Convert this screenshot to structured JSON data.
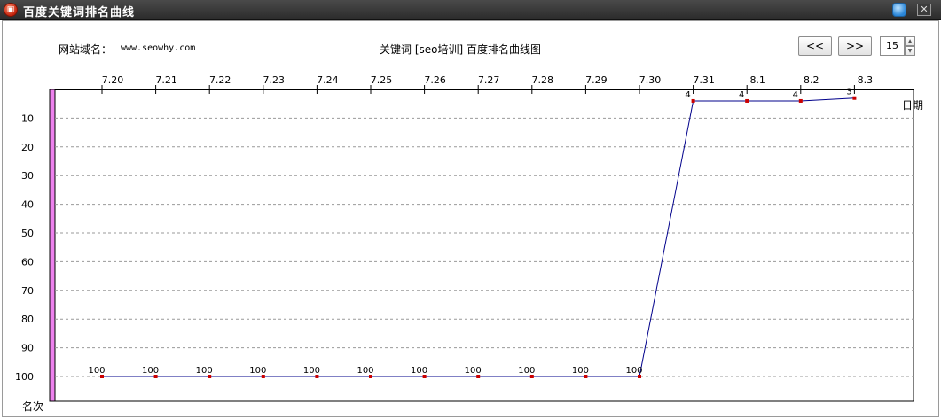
{
  "window": {
    "title": "百度关键词排名曲线"
  },
  "header": {
    "site_label": "网站域名：",
    "site_value": "www.seowhy.com",
    "chart_title": "关键词 [seo培训] 百度排名曲线图",
    "prev_label": "<<",
    "next_label": ">>",
    "days_value": "15"
  },
  "chart_data": {
    "type": "line",
    "x": [
      "7.20",
      "7.21",
      "7.22",
      "7.23",
      "7.24",
      "7.25",
      "7.26",
      "7.27",
      "7.28",
      "7.29",
      "7.30",
      "7.31",
      "8.1",
      "8.2",
      "8.3"
    ],
    "series": [
      {
        "values": [
          100,
          100,
          100,
          100,
          100,
          100,
          100,
          100,
          100,
          100,
          100,
          4,
          4,
          4,
          3
        ]
      }
    ],
    "xlabel": "日期",
    "ylabel": "名次",
    "yticks": [
      10,
      20,
      30,
      40,
      50,
      60,
      70,
      80,
      90,
      100
    ],
    "ylim": [
      0,
      100
    ],
    "y_inverted": true,
    "grid": true,
    "colors": {
      "line": "#00008b",
      "marker": "#cc0000",
      "axis_band": "#ee82ee",
      "grid": "#999999"
    }
  }
}
